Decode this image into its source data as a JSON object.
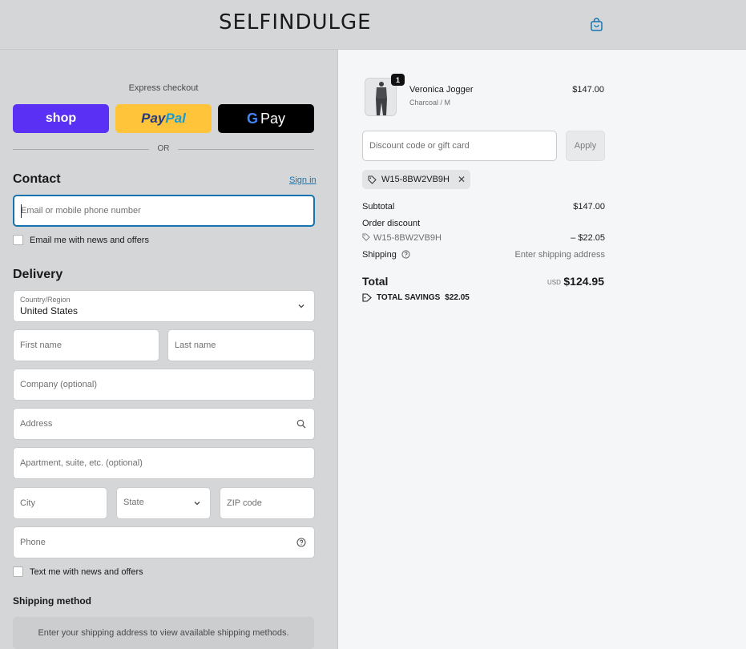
{
  "header": {
    "logo": "SELFINDULGE",
    "cart_icon": "shopping-bag-icon"
  },
  "express": {
    "label": "Express checkout",
    "shop_label": "shop",
    "paypal_pay": "Pay",
    "paypal_pal": "Pal",
    "gpay_g": "G",
    "gpay_label": "Pay",
    "or_label": "OR"
  },
  "contact": {
    "title": "Contact",
    "sign_in": "Sign in",
    "email_placeholder": "Email or mobile phone number",
    "news_checkbox": "Email me with news and offers"
  },
  "delivery": {
    "title": "Delivery",
    "country_label": "Country/Region",
    "country_value": "United States",
    "first_name": "First name",
    "last_name": "Last name",
    "company": "Company (optional)",
    "address": "Address",
    "apartment": "Apartment, suite, etc. (optional)",
    "city": "City",
    "state": "State",
    "zip": "ZIP code",
    "phone": "Phone",
    "text_checkbox": "Text me with news and offers"
  },
  "shipping": {
    "title": "Shipping method",
    "message": "Enter your shipping address to view available shipping methods."
  },
  "summary": {
    "product": {
      "quantity": "1",
      "name": "Veronica Jogger",
      "variant": "Charcoal / M",
      "price": "$147.00"
    },
    "discount_placeholder": "Discount code or gift card",
    "apply_label": "Apply",
    "applied_code": "W15-8BW2VB9H",
    "subtotal_label": "Subtotal",
    "subtotal_value": "$147.00",
    "order_discount_label": "Order discount",
    "order_discount_code": "W15-8BW2VB9H",
    "order_discount_value": "– $22.05",
    "shipping_label": "Shipping",
    "shipping_value": "Enter shipping address",
    "total_label": "Total",
    "currency": "USD",
    "total_value": "$124.95",
    "savings_label": "TOTAL SAVINGS",
    "savings_value": "$22.05"
  }
}
